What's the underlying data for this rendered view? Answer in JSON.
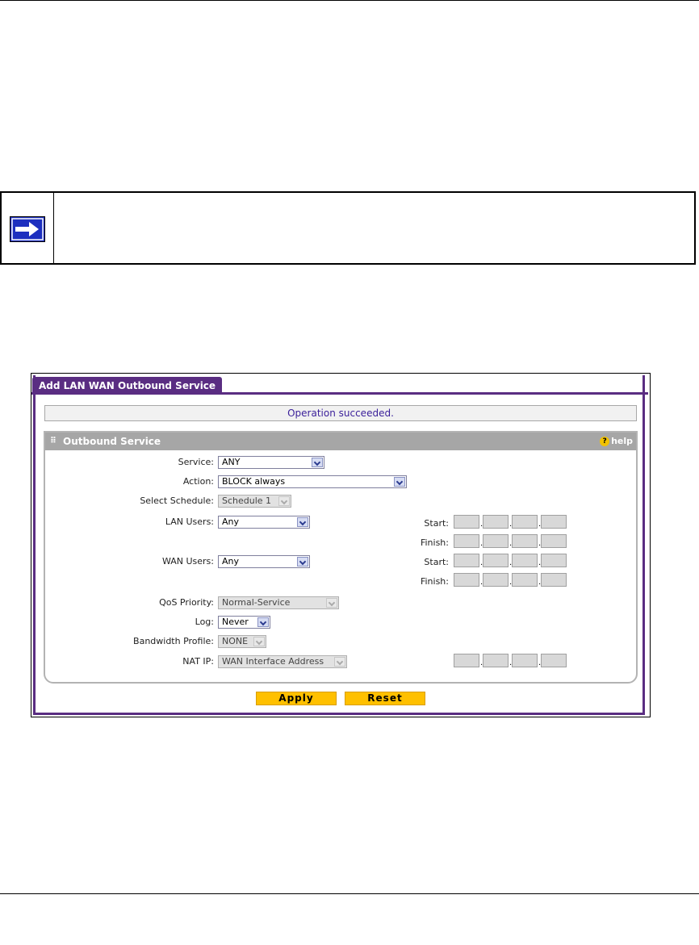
{
  "window": {
    "tab_title": "Add LAN WAN Outbound Service",
    "status_message": "Operation succeeded."
  },
  "panel": {
    "title": "Outbound Service",
    "help_label": "help"
  },
  "form": {
    "service": {
      "label": "Service:",
      "value": "ANY"
    },
    "action": {
      "label": "Action:",
      "value": "BLOCK always"
    },
    "schedule": {
      "label": "Select Schedule:",
      "value": "Schedule 1"
    },
    "lan_users": {
      "label": "LAN Users:",
      "value": "Any"
    },
    "wan_users": {
      "label": "WAN Users:",
      "value": "Any"
    },
    "qos": {
      "label": "QoS Priority:",
      "value": "Normal-Service"
    },
    "log": {
      "label": "Log:",
      "value": "Never"
    },
    "bandwidth": {
      "label": "Bandwidth Profile:",
      "value": "NONE"
    },
    "nat_ip": {
      "label": "NAT IP:",
      "value": "WAN Interface Address"
    },
    "start_label": "Start:",
    "finish_label": "Finish:"
  },
  "buttons": {
    "apply": "Apply",
    "reset": "Reset"
  },
  "colors": {
    "accent": "#5a2d82",
    "button": "#ffc000",
    "note_icon": "#1d2fbf"
  }
}
